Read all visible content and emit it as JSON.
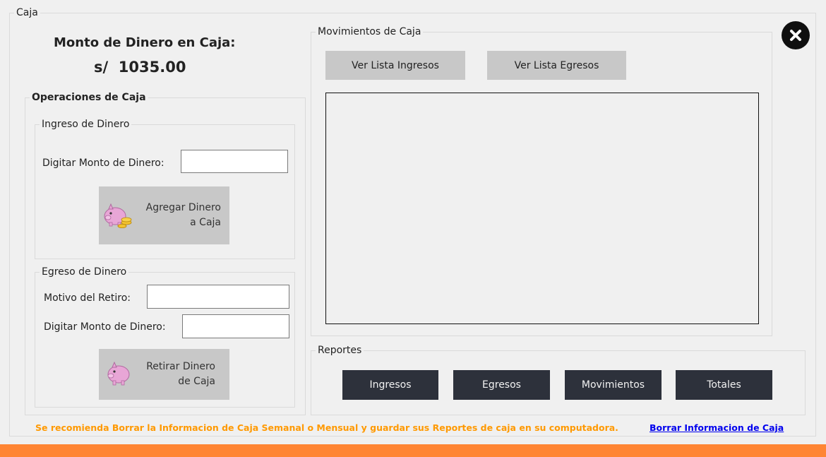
{
  "window": {
    "title": "Caja"
  },
  "summary": {
    "title": "Monto de Dinero en Caja:",
    "currency": "s/",
    "amount": "1035.00"
  },
  "operations": {
    "legend": "Operaciones de Caja",
    "deposit": {
      "legend": "Ingreso de Dinero",
      "amount_label": "Digitar Monto de Dinero:",
      "amount_value": "",
      "button_line1": "Agregar Dinero",
      "button_line2": "a Caja",
      "icon": "piggy-bank-coins-icon"
    },
    "withdraw": {
      "legend": "Egreso de Dinero",
      "reason_label": "Motivo del Retiro:",
      "reason_value": "",
      "amount_label": "Digitar Monto de Dinero:",
      "amount_value": "",
      "button_line1": "Retirar Dinero",
      "button_line2": "de Caja",
      "icon": "piggy-bank-icon"
    }
  },
  "movements": {
    "legend": "Movimientos de Caja",
    "btn_incomes": "Ver Lista Ingresos",
    "btn_expenses": "Ver Lista Egresos"
  },
  "reports": {
    "legend": "Reportes",
    "buttons": [
      "Ingresos",
      "Egresos",
      "Movimientos",
      "Totales"
    ]
  },
  "footer": {
    "notice": "Se recomienda Borrar la Informacion de Caja Semanal o Mensual y guardar sus Reportes de caja en su computadora.",
    "link": "Borrar Informacion de Caja"
  },
  "colors": {
    "accent_orange": "#ff8533",
    "notice_text": "#ff9900",
    "link": "#0000ee",
    "dark_button": "#2d313b",
    "gray_button": "#c8c8c8"
  }
}
